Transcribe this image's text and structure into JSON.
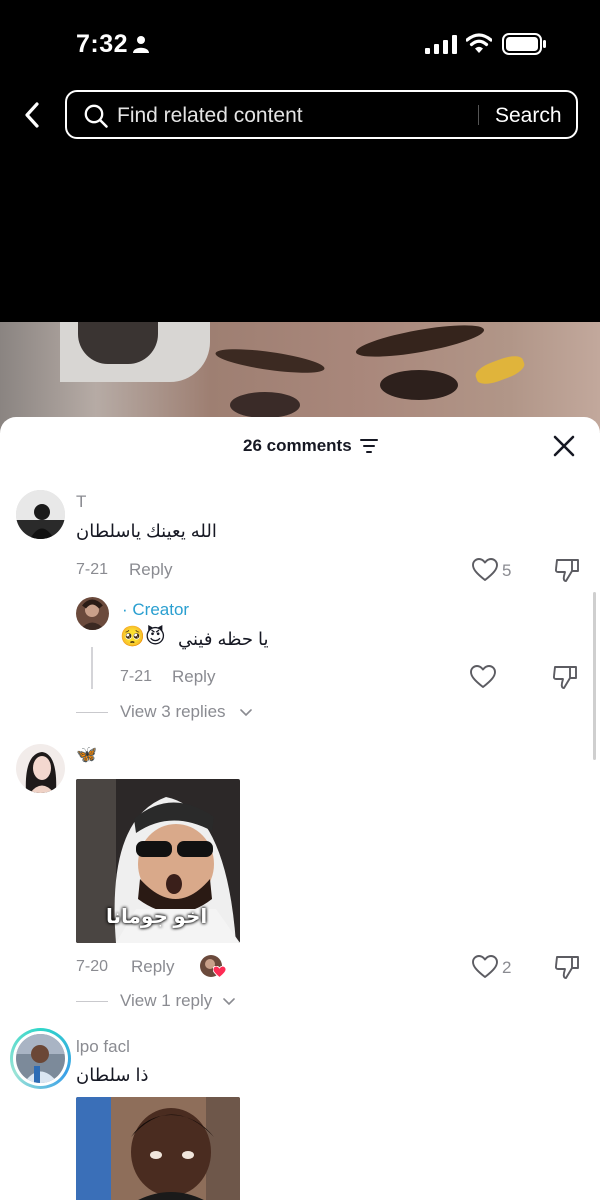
{
  "status_bar": {
    "time": "7:32",
    "icons": [
      "person-icon",
      "signal-icon",
      "wifi-icon",
      "battery-icon"
    ]
  },
  "search": {
    "placeholder": "Find related content",
    "button_label": "Search",
    "back_icon": "chevron-left-icon"
  },
  "sheet": {
    "title": "26 comments",
    "filter_icon": "filter-icon",
    "close_icon": "close-icon"
  },
  "comments": [
    {
      "username": "T",
      "text": "الله يعينك ياسلطان",
      "date": "7-21",
      "reply_label": "Reply",
      "likes": "5",
      "reply": {
        "creator_label": "· Creator",
        "text": "يا حظه فيني",
        "emojis": "🥺😈",
        "date": "7-21",
        "reply_label": "Reply"
      },
      "view_replies": "View 3 replies"
    },
    {
      "username": "🦋",
      "sticker_caption": "اخو جومانا",
      "date": "7-20",
      "reply_label": "Reply",
      "likes": "2",
      "view_replies": "View 1 reply"
    },
    {
      "username": "lpo facl",
      "text": "ذا سلطان"
    }
  ],
  "colors": {
    "creator": "#2a9fd0",
    "muted": "#8a8b91",
    "text": "#161823",
    "like_badge": "#fe2c55"
  }
}
